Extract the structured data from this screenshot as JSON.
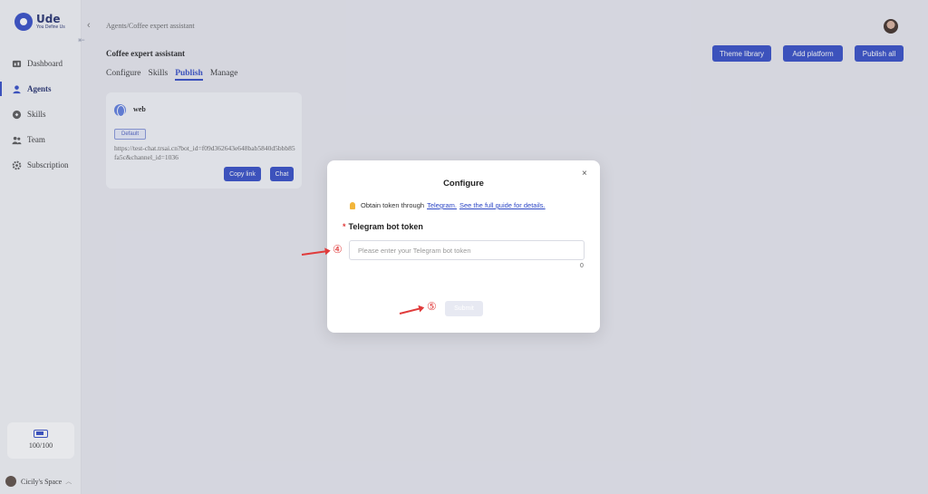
{
  "app": {
    "name": "Ude",
    "tagline": "You Define Us"
  },
  "sidebar": {
    "items": [
      {
        "label": "Dashboard",
        "icon": "dashboard-icon"
      },
      {
        "label": "Agents",
        "icon": "agents-icon",
        "active": true
      },
      {
        "label": "Skills",
        "icon": "skills-icon"
      },
      {
        "label": "Team",
        "icon": "team-icon"
      },
      {
        "label": "Subscription",
        "icon": "subscription-icon"
      }
    ],
    "quota": "100/100",
    "space": "Cicily's Space"
  },
  "header": {
    "breadcrumb": "Agents/Coffee expert assistant",
    "title": "Coffee expert assistant",
    "buttons": {
      "theme": "Theme library",
      "add_platform": "Add platform",
      "publish_all": "Publish all"
    }
  },
  "tabs": [
    {
      "label": "Configure"
    },
    {
      "label": "Skills"
    },
    {
      "label": "Publish",
      "active": true
    },
    {
      "label": "Manage"
    }
  ],
  "card": {
    "name": "web",
    "badge": "Default",
    "url": "https://test-chat.trsai.cn?bot_id=f09d362643e648bab5840d5bbb85fa5c&channel_id=1036",
    "copy_label": "Copy link",
    "chat_label": "Chat"
  },
  "modal": {
    "title": "Configure",
    "close": "×",
    "hint_prefix": "Obtain token through",
    "hint_link1": "Telegram.",
    "hint_link2": "See the full guide for details.",
    "field_label": "Telegram bot token",
    "required_mark": "*",
    "placeholder": "Please enter your Telegram bot token",
    "value": "",
    "counter": "0",
    "submit": "Submit"
  },
  "annotations": {
    "step4": "④",
    "step5": "⑤"
  },
  "colors": {
    "primary": "#2f49c6",
    "danger": "#e03b3b"
  }
}
